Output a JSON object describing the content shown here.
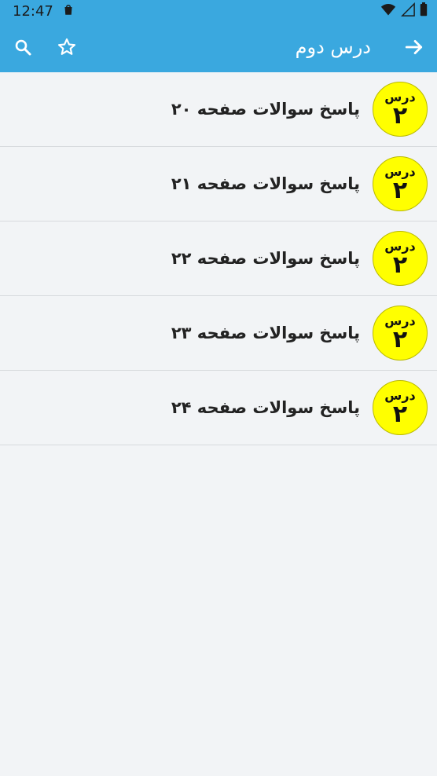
{
  "status_bar": {
    "time": "12:47"
  },
  "app_bar": {
    "title": "درس دوم"
  },
  "list": {
    "items": [
      {
        "badge_top": "درس",
        "badge_num": "۲",
        "title": "پاسخ سوالات صفحه ۲۰"
      },
      {
        "badge_top": "درس",
        "badge_num": "۲",
        "title": "پاسخ سوالات صفحه ۲۱"
      },
      {
        "badge_top": "درس",
        "badge_num": "۲",
        "title": "پاسخ سوالات صفحه ۲۲"
      },
      {
        "badge_top": "درس",
        "badge_num": "۲",
        "title": "پاسخ سوالات صفحه ۲۳"
      },
      {
        "badge_top": "درس",
        "badge_num": "۲",
        "title": "پاسخ سوالات صفحه ۲۴"
      }
    ]
  },
  "colors": {
    "primary": "#3aa8df",
    "badge": "#ffff00",
    "background": "#f2f4f6"
  }
}
